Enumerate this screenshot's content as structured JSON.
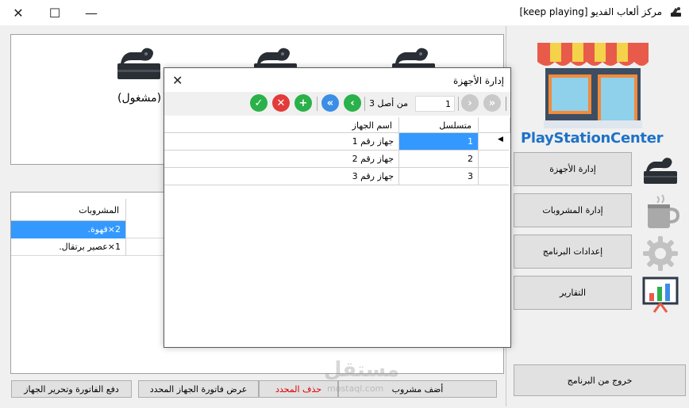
{
  "window": {
    "title": "مركز ألعاب الفديو [keep playing]",
    "minimize_glyph": "—",
    "maximize_glyph": "☐",
    "close_glyph": "✕"
  },
  "devices": {
    "status_label": "(مشغول)"
  },
  "drinks_grid": {
    "header": "المشروبات",
    "rows": [
      "2×قهوة.",
      "1×عصير برتقال."
    ]
  },
  "bottom_buttons": {
    "add_drink": "أضف مشروب",
    "delete_selected": "حذف المحدد",
    "show_invoice": "عرض فاتورة الجهاز المحدد",
    "pay_and_release": "دفع الفاتورة وتحرير الجهاز"
  },
  "sidebar": {
    "brand": "PlayStationCenter",
    "items": [
      {
        "label": "إدارة الأجهزة",
        "icon": "console-icon"
      },
      {
        "label": "إدارة المشروبات",
        "icon": "coffee-cup-icon"
      },
      {
        "label": "إعدادات البرنامج",
        "icon": "gear-icon"
      },
      {
        "label": "التقارير",
        "icon": "chart-board-icon"
      }
    ],
    "exit": "خروج من البرنامج"
  },
  "dialog": {
    "title": "إدارة الأجهزة",
    "close_glyph": "✕",
    "toolbar": {
      "position": "1",
      "of_label": "من أصل 3"
    },
    "columns": [
      "متسلسل",
      "اسم الجهاز"
    ],
    "rows": [
      {
        "serial": "1",
        "name": "جهاز رقم 1"
      },
      {
        "serial": "2",
        "name": "جهاز رقم 2"
      },
      {
        "serial": "3",
        "name": "جهاز رقم 3"
      }
    ]
  },
  "watermark": {
    "text": "مستقل",
    "sub": "mostaql.com"
  },
  "colors": {
    "selection": "#3399ff",
    "brand_blue": "#1e72c8",
    "save_green": "#2ab14a",
    "cancel_red": "#e23b3b",
    "nav_blue": "#3b8ee6"
  }
}
